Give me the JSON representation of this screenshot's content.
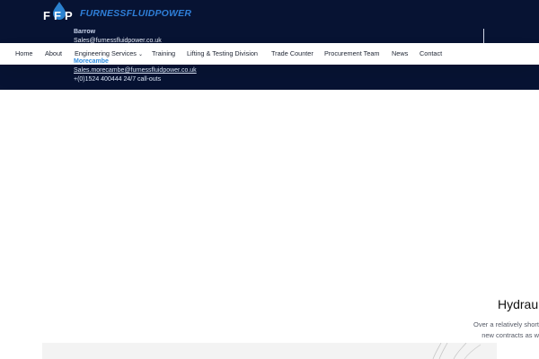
{
  "brand": {
    "logo_initials": "FFP",
    "logo_text": "FURNESSFLUIDPOWER",
    "accent_color": "#2f8ee0",
    "header_bg": "#071333"
  },
  "contacts": {
    "barrow": {
      "label": "Barrow",
      "email": "Sales@furnessfluidpower.co.uk"
    },
    "morecambe": {
      "label": "Morecambe",
      "email": "Sales.morecambe@furnessfluidpower.co.uk",
      "phone": "+(0)1524 400444 24/7 call-outs"
    }
  },
  "nav": {
    "items": [
      {
        "label": "Home"
      },
      {
        "label": "About"
      },
      {
        "label": "Engineering Services",
        "dropdown_icon": "chevron-down-icon"
      },
      {
        "label": "Training"
      },
      {
        "label": "Lifting & Testing Division"
      },
      {
        "label": "Trade Counter"
      },
      {
        "label": "Procurement Team"
      },
      {
        "label": "News"
      },
      {
        "label": "Contact"
      }
    ]
  },
  "hero": {
    "title": "Hydrau",
    "text_line1": "Over a relatively short",
    "text_line2": "new contracts as w"
  }
}
